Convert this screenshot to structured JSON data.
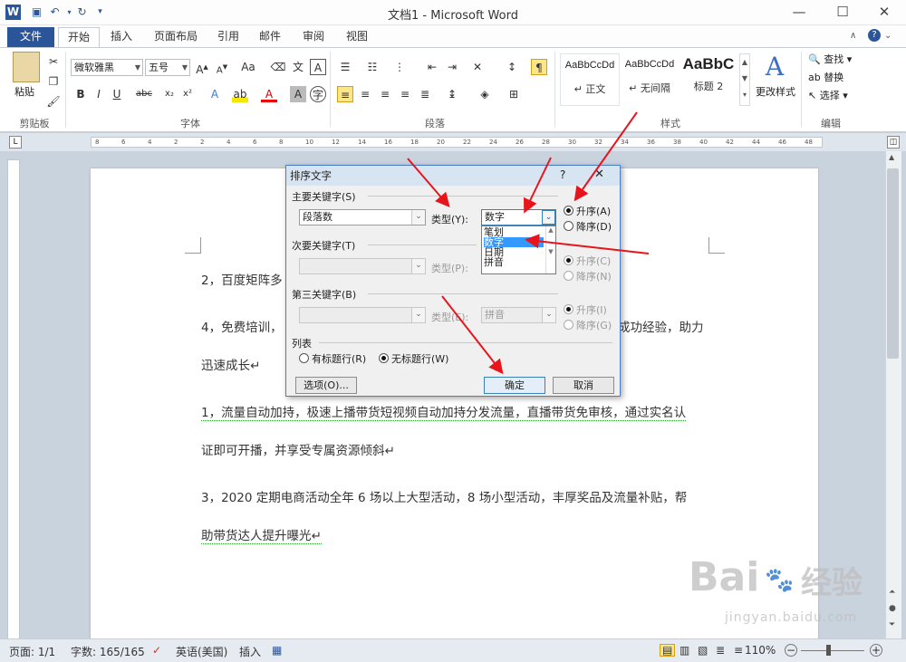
{
  "window": {
    "title": "文档1 - Microsoft Word",
    "controls": [
      "minimize",
      "maximize",
      "close"
    ]
  },
  "tabs": [
    {
      "label": "文件"
    },
    {
      "label": "开始"
    },
    {
      "label": "插入"
    },
    {
      "label": "页面布局"
    },
    {
      "label": "引用"
    },
    {
      "label": "邮件"
    },
    {
      "label": "审阅"
    },
    {
      "label": "视图"
    }
  ],
  "ribbon": {
    "clipboard": {
      "group": "剪贴板",
      "paste": "粘贴"
    },
    "font": {
      "group": "字体",
      "name": "微软雅黑",
      "size": "五号",
      "change_case": "Aa"
    },
    "paragraph": {
      "group": "段落"
    },
    "styles": {
      "group": "样式",
      "items": [
        {
          "sample": "AaBbCcDd",
          "name": "↵ 正文"
        },
        {
          "sample": "AaBbCcDd",
          "name": "↵ 无间隔"
        },
        {
          "sample": "AaBbC",
          "name": "标题 2"
        }
      ],
      "change_styles": "更改样式"
    },
    "editing": {
      "group": "编辑",
      "find": "查找",
      "replace": "替换",
      "select": "选择"
    }
  },
  "ruler": {
    "marks": [
      "8",
      "6",
      "4",
      "2",
      "2",
      "4",
      "6",
      "8",
      "10",
      "12",
      "14",
      "16",
      "18",
      "20",
      "22",
      "24",
      "26",
      "28",
      "30",
      "32",
      "34",
      "36",
      "38",
      "40",
      "42",
      "44",
      "46",
      "48"
    ]
  },
  "document": {
    "paragraphs": [
      {
        "text": "2，百度矩阵多"
      },
      {
        "text": "4，免费培训，",
        "tail": "成功经验，助力"
      },
      {
        "text": "迅速成长↵"
      },
      {
        "text": "1，流量自动加持，极速上播带货短视频自动加持分发流量，直播带货免审核，通过实名认"
      },
      {
        "text": "证即可开播，并享受专属资源倾斜↵"
      },
      {
        "text": "3，2020 定期电商活动全年 6 场以上大型活动，8 场小型活动，丰厚奖品及流量补贴，帮"
      },
      {
        "text": "助带货达人提升曝光↵"
      }
    ]
  },
  "dialog": {
    "title": "排序文字",
    "help": "?",
    "close": "✕",
    "primary": {
      "label": "主要关键字(S)",
      "key": "段落数",
      "type_label": "类型(Y):",
      "type_value": "数字",
      "asc": "升序(A)",
      "desc": "降序(D)",
      "type_options": [
        "笔划",
        "数字",
        "日期",
        "拼音"
      ],
      "selected_option": "数字"
    },
    "secondary": {
      "label": "次要关键字(T)",
      "type_label": "类型(P):",
      "asc": "升序(C)",
      "desc": "降序(N)"
    },
    "tertiary": {
      "label": "第三关键字(B)",
      "type_label": "类型(E):",
      "type_value": "拼音",
      "asc": "升序(I)",
      "desc": "降序(G)"
    },
    "list": {
      "label": "列表",
      "with_header": "有标题行(R)",
      "no_header": "无标题行(W)"
    },
    "options_button": "选项(O)...",
    "ok_button": "确定",
    "cancel_button": "取消"
  },
  "statusbar": {
    "page": "页面: 1/1",
    "words": "字数: 165/165",
    "language": "英语(美国)",
    "insert_mode": "插入",
    "zoom": "110%"
  },
  "watermark": {
    "brand": "Bai",
    "brand_cn": "经验",
    "url": "jingyan.baidu.com"
  },
  "colors": {
    "file_tab": "#2a5699",
    "dialog_border": "#4a7fc6",
    "selection": "#3399ff",
    "annotation": "#e8141c"
  }
}
